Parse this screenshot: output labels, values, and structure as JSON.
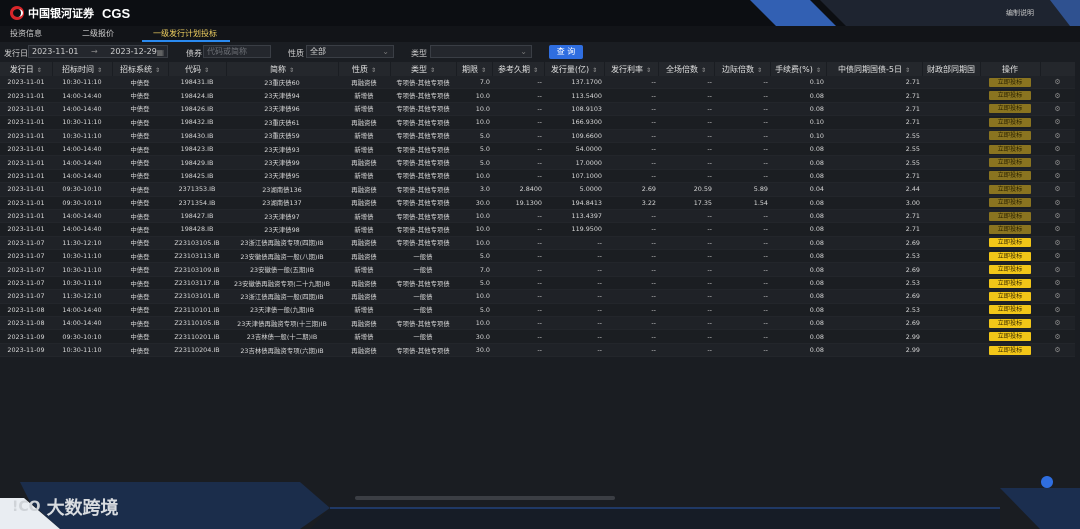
{
  "app": {
    "brand": "中国银河证券",
    "brand_en": "CGS",
    "header_link": "编制说明"
  },
  "tabs": [
    {
      "label": "投资信息",
      "active": false
    },
    {
      "label": "二级报价",
      "active": false
    },
    {
      "label": "一级发行计划投标",
      "active": true
    }
  ],
  "filters": {
    "date_label": "发行日",
    "date_from": "2023-11-01",
    "arrow": "→",
    "date_to": "2023-12-29",
    "bond_label": "债券",
    "bond_placeholder": "代码或简称",
    "nature_label": "性质",
    "nature_value": "全部",
    "type_label": "类型",
    "type_value": "",
    "query_label": "查 询"
  },
  "table": {
    "columns": [
      "发行日",
      "招标时间",
      "招标系统",
      "代码",
      "简称",
      "性质",
      "类型",
      "期限",
      "参考久期",
      "发行量(亿)",
      "发行利率",
      "全场倍数",
      "边际倍数",
      "手续费(%)",
      "中债同期国债-5日",
      "财政部同期国",
      "操作"
    ],
    "sortable": [
      true,
      true,
      true,
      true,
      true,
      true,
      true,
      true,
      true,
      true,
      true,
      true,
      true,
      true,
      true,
      false,
      false
    ],
    "rows": [
      [
        "2023-11-01",
        "10:30-11:10",
        "中债登",
        "198431.IB",
        "23重庆债60",
        "再融资债",
        "专项债-其他专项债",
        "7.0",
        "--",
        "137.1700",
        "--",
        "--",
        "--",
        "0.10",
        "2.71",
        "",
        ""
      ],
      [
        "2023-11-01",
        "14:00-14:40",
        "中债登",
        "198424.IB",
        "23天津债94",
        "新增债",
        "专项债-其他专项债",
        "10.0",
        "--",
        "113.5400",
        "--",
        "--",
        "--",
        "0.08",
        "2.71",
        "",
        ""
      ],
      [
        "2023-11-01",
        "14:00-14:40",
        "中债登",
        "198426.IB",
        "23天津债96",
        "新增债",
        "专项债-其他专项债",
        "10.0",
        "--",
        "108.9103",
        "--",
        "--",
        "--",
        "0.08",
        "2.71",
        "",
        ""
      ],
      [
        "2023-11-01",
        "10:30-11:10",
        "中债登",
        "198432.IB",
        "23重庆债61",
        "再融资债",
        "专项债-其他专项债",
        "10.0",
        "--",
        "166.9300",
        "--",
        "--",
        "--",
        "0.10",
        "2.71",
        "",
        ""
      ],
      [
        "2023-11-01",
        "10:30-11:10",
        "中债登",
        "198430.IB",
        "23重庆债59",
        "新增债",
        "专项债-其他专项债",
        "5.0",
        "--",
        "109.6600",
        "--",
        "--",
        "--",
        "0.10",
        "2.55",
        "",
        ""
      ],
      [
        "2023-11-01",
        "14:00-14:40",
        "中债登",
        "198423.IB",
        "23天津债93",
        "新增债",
        "专项债-其他专项债",
        "5.0",
        "--",
        "54.0000",
        "--",
        "--",
        "--",
        "0.08",
        "2.55",
        "",
        ""
      ],
      [
        "2023-11-01",
        "14:00-14:40",
        "中债登",
        "198429.IB",
        "23天津债99",
        "再融资债",
        "专项债-其他专项债",
        "5.0",
        "--",
        "17.0000",
        "--",
        "--",
        "--",
        "0.08",
        "2.55",
        "",
        ""
      ],
      [
        "2023-11-01",
        "14:00-14:40",
        "中债登",
        "198425.IB",
        "23天津债95",
        "新增债",
        "专项债-其他专项债",
        "10.0",
        "--",
        "107.1000",
        "--",
        "--",
        "--",
        "0.08",
        "2.71",
        "",
        ""
      ],
      [
        "2023-11-01",
        "09:30-10:10",
        "中债登",
        "2371353.IB",
        "23湖南债136",
        "再融资债",
        "专项债-其他专项债",
        "3.0",
        "2.8400",
        "5.0000",
        "2.69",
        "20.59",
        "5.89",
        "0.04",
        "2.44",
        "",
        ""
      ],
      [
        "2023-11-01",
        "09:30-10:10",
        "中债登",
        "2371354.IB",
        "23湖南债137",
        "再融资债",
        "专项债-其他专项债",
        "30.0",
        "19.1300",
        "194.8413",
        "3.22",
        "17.35",
        "1.54",
        "0.08",
        "3.00",
        "",
        ""
      ],
      [
        "2023-11-01",
        "14:00-14:40",
        "中债登",
        "198427.IB",
        "23天津债97",
        "新增债",
        "专项债-其他专项债",
        "10.0",
        "--",
        "113.4397",
        "--",
        "--",
        "--",
        "0.08",
        "2.71",
        "",
        ""
      ],
      [
        "2023-11-01",
        "14:00-14:40",
        "中债登",
        "198428.IB",
        "23天津债98",
        "新增债",
        "专项债-其他专项债",
        "10.0",
        "--",
        "119.9500",
        "--",
        "--",
        "--",
        "0.08",
        "2.71",
        "",
        ""
      ],
      [
        "2023-11-07",
        "11:30-12:10",
        "中债登",
        "Z23103105.IB",
        "23浙江债再融资专项(四期)IB",
        "再融资债",
        "专项债-其他专项债",
        "10.0",
        "--",
        "--",
        "--",
        "--",
        "--",
        "0.08",
        "2.69",
        "",
        ""
      ],
      [
        "2023-11-07",
        "10:30-11:10",
        "中债登",
        "Z23103113.IB",
        "23安徽债再融资一般(八期)IB",
        "再融资债",
        "一般债",
        "5.0",
        "--",
        "--",
        "--",
        "--",
        "--",
        "0.08",
        "2.53",
        "",
        ""
      ],
      [
        "2023-11-07",
        "10:30-11:10",
        "中债登",
        "Z23103109.IB",
        "23安徽债一般(五期)IB",
        "新增债",
        "一般债",
        "7.0",
        "--",
        "--",
        "--",
        "--",
        "--",
        "0.08",
        "2.69",
        "",
        ""
      ],
      [
        "2023-11-07",
        "10:30-11:10",
        "中债登",
        "Z23103117.IB",
        "23安徽债再融资专项(二十九期)IB",
        "再融资债",
        "专项债-其他专项债",
        "5.0",
        "--",
        "--",
        "--",
        "--",
        "--",
        "0.08",
        "2.53",
        "",
        ""
      ],
      [
        "2023-11-07",
        "11:30-12:10",
        "中债登",
        "Z23103101.IB",
        "23浙江债再融资一般(四期)IB",
        "再融资债",
        "一般债",
        "10.0",
        "--",
        "--",
        "--",
        "--",
        "--",
        "0.08",
        "2.69",
        "",
        ""
      ],
      [
        "2023-11-08",
        "14:00-14:40",
        "中债登",
        "Z23110101.IB",
        "23天津债一般(九期)IB",
        "新增债",
        "一般债",
        "5.0",
        "--",
        "--",
        "--",
        "--",
        "--",
        "0.08",
        "2.53",
        "",
        ""
      ],
      [
        "2023-11-08",
        "14:00-14:40",
        "中债登",
        "Z23110105.IB",
        "23天津债再融资专项(十三期)IB",
        "再融资债",
        "专项债-其他专项债",
        "10.0",
        "--",
        "--",
        "--",
        "--",
        "--",
        "0.08",
        "2.69",
        "",
        ""
      ],
      [
        "2023-11-09",
        "09:30-10:10",
        "中债登",
        "Z23110201.IB",
        "23吉林债一般(十二期)IB",
        "新增债",
        "一般债",
        "30.0",
        "--",
        "--",
        "--",
        "--",
        "--",
        "0.08",
        "2.99",
        "",
        ""
      ],
      [
        "2023-11-09",
        "10:30-11:10",
        "中债登",
        "Z23110204.IB",
        "23吉林债再融资专项(六期)IB",
        "再融资债",
        "专项债-其他专项债",
        "30.0",
        "--",
        "--",
        "--",
        "--",
        "--",
        "0.08",
        "2.99",
        "",
        ""
      ]
    ],
    "action_label": "立即投标",
    "bright_from_row": 12
  },
  "watermark": {
    "logo": "!CO",
    "text": "大数跨境"
  },
  "colors": {
    "accent": "#2f6ee0",
    "bid_button": "#f2c618",
    "bid_button_dim": "#8a7420",
    "active_tab": "#f0d060"
  },
  "icons": {
    "gear": "gear-icon",
    "calendar": "calendar-icon",
    "chevron": "chevron-down-icon"
  }
}
